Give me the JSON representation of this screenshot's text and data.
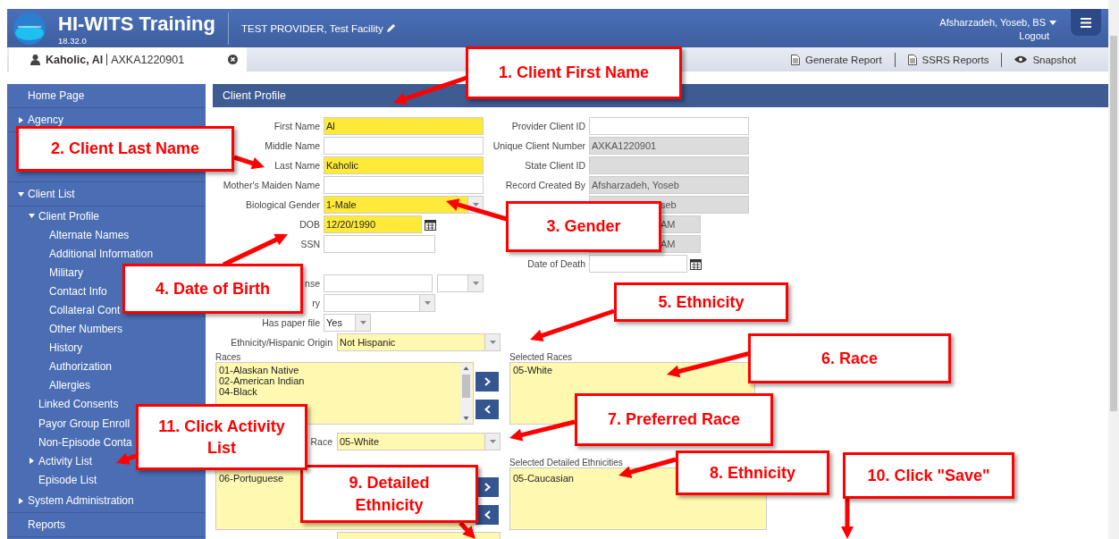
{
  "header": {
    "title": "HI-WITS Training",
    "version": "18.32.0",
    "provider": "TEST PROVIDER, Test Facility",
    "user": "Afsharzadeh, Yoseb, BS",
    "logout": "Logout"
  },
  "client_tab": {
    "name": "Kaholic, Al",
    "number": "AXKA1220901",
    "selected": true
  },
  "toolbar": [
    "Generate Report",
    "SSRS Reports",
    "Snapshot"
  ],
  "sidebar": {
    "items": [
      {
        "label": "Home Page"
      },
      {
        "label": "Agency",
        "expanded": false
      },
      {
        "label": "Client List",
        "expanded": true,
        "children": [
          {
            "label": "Client Profile",
            "expanded": true,
            "children": [
              {
                "label": "Alternate Names"
              },
              {
                "label": "Additional Information"
              },
              {
                "label": "Military"
              },
              {
                "label": "Contact Info"
              },
              {
                "label": "Collateral Cont"
              },
              {
                "label": "Other Numbers"
              },
              {
                "label": "History"
              },
              {
                "label": "Authorization"
              },
              {
                "label": "Allergies"
              }
            ]
          },
          {
            "label": "Linked Consents"
          },
          {
            "label": "Payor Group Enroll"
          },
          {
            "label": "Non-Episode Conta"
          },
          {
            "label": "Activity List",
            "expanded": false
          },
          {
            "label": "Episode List"
          }
        ]
      },
      {
        "label": "System Administration",
        "expanded": false
      },
      {
        "label": "Reports"
      }
    ]
  },
  "panel": {
    "title": "Client Profile"
  },
  "left_fields": [
    {
      "label": "First Name",
      "kind": "text",
      "value": "Al",
      "required": true
    },
    {
      "label": "Middle Name",
      "kind": "text",
      "required": false
    },
    {
      "label": "Last Name",
      "kind": "text",
      "value": "Kaholic",
      "required": true
    },
    {
      "label": "Mother's Maiden Name",
      "kind": "text",
      "required": false
    },
    {
      "label": "Biological Gender",
      "kind": "select",
      "value": "1-Male",
      "required": true
    },
    {
      "label": "DOB",
      "kind": "date",
      "value": "12/20/1990",
      "required": true
    },
    {
      "label": "SSN",
      "kind": "short",
      "required": false
    },
    {
      "kind": "blank"
    },
    {
      "label": "nse",
      "kind": "text-select",
      "required": false
    },
    {
      "label": "ry",
      "kind": "select",
      "required": false
    },
    {
      "label": "Has paper file",
      "kind": "tiny-select",
      "value": "Yes",
      "required": false
    }
  ],
  "right_fields": [
    {
      "label": "Provider Client ID",
      "kind": "text",
      "readonly": false
    },
    {
      "label": "Unique Client Number",
      "kind": "text",
      "value": "AXKA1220901",
      "readonly": true
    },
    {
      "label": "State Client ID",
      "kind": "text",
      "readonly": true
    },
    {
      "label": "Record Created By",
      "kind": "text",
      "value": "Afsharzadeh, Yoseb",
      "readonly": true
    },
    {
      "kind": "text",
      "value": "seb",
      "readonly": true
    },
    {
      "kind": "short",
      "value": "AM",
      "readonly": true
    },
    {
      "kind": "short",
      "value": "AM",
      "readonly": true
    },
    {
      "label": "Date of Death",
      "kind": "date",
      "readonly": false
    }
  ],
  "ethnicity": {
    "label": "Ethnicity/Hispanic Origin",
    "value": "Not Hispanic"
  },
  "races": {
    "label": "Races",
    "options": [
      "01-Alaskan Native",
      "02-American Indian",
      "04-Black"
    ],
    "selected_label": "Selected Races",
    "selected": [
      "05-White"
    ]
  },
  "preferred_race": {
    "label": "Race",
    "value": "05-White"
  },
  "detailed": {
    "options": [
      "06-Portuguese"
    ],
    "selected_label": "Selected Detailed Ethnicities",
    "selected": [
      "05-Caucasian"
    ]
  },
  "callouts": [
    "1. Client First Name",
    "2. Client Last Name",
    "3. Gender",
    "4. Date of Birth",
    "5. Ethnicity",
    "6. Race",
    "7. Preferred Race",
    "8. Ethnicity",
    "9. Detailed Ethnicity",
    "10. Click \"Save\"",
    "11. Click Activity List"
  ]
}
